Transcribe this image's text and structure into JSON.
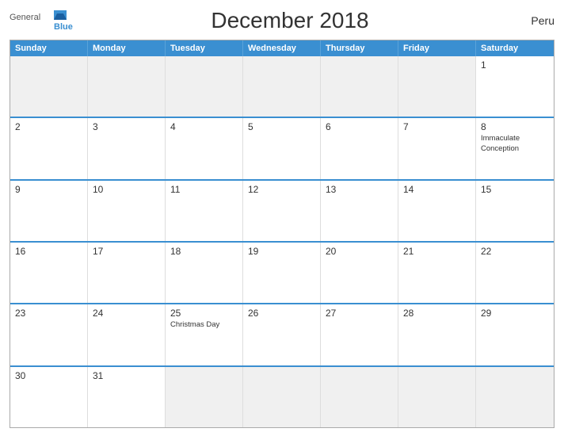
{
  "header": {
    "logo_general": "General",
    "logo_blue": "Blue",
    "title": "December 2018",
    "country": "Peru"
  },
  "weekdays": [
    "Sunday",
    "Monday",
    "Tuesday",
    "Wednesday",
    "Thursday",
    "Friday",
    "Saturday"
  ],
  "weeks": [
    [
      {
        "day": "",
        "empty": true
      },
      {
        "day": "",
        "empty": true
      },
      {
        "day": "",
        "empty": true
      },
      {
        "day": "",
        "empty": true
      },
      {
        "day": "",
        "empty": true
      },
      {
        "day": "",
        "empty": true
      },
      {
        "day": "1",
        "event": ""
      }
    ],
    [
      {
        "day": "2",
        "event": ""
      },
      {
        "day": "3",
        "event": ""
      },
      {
        "day": "4",
        "event": ""
      },
      {
        "day": "5",
        "event": ""
      },
      {
        "day": "6",
        "event": ""
      },
      {
        "day": "7",
        "event": ""
      },
      {
        "day": "8",
        "event": "Immaculate Conception"
      }
    ],
    [
      {
        "day": "9",
        "event": ""
      },
      {
        "day": "10",
        "event": ""
      },
      {
        "day": "11",
        "event": ""
      },
      {
        "day": "12",
        "event": ""
      },
      {
        "day": "13",
        "event": ""
      },
      {
        "day": "14",
        "event": ""
      },
      {
        "day": "15",
        "event": ""
      }
    ],
    [
      {
        "day": "16",
        "event": ""
      },
      {
        "day": "17",
        "event": ""
      },
      {
        "day": "18",
        "event": ""
      },
      {
        "day": "19",
        "event": ""
      },
      {
        "day": "20",
        "event": ""
      },
      {
        "day": "21",
        "event": ""
      },
      {
        "day": "22",
        "event": ""
      }
    ],
    [
      {
        "day": "23",
        "event": ""
      },
      {
        "day": "24",
        "event": ""
      },
      {
        "day": "25",
        "event": "Christmas Day"
      },
      {
        "day": "26",
        "event": ""
      },
      {
        "day": "27",
        "event": ""
      },
      {
        "day": "28",
        "event": ""
      },
      {
        "day": "29",
        "event": ""
      }
    ],
    [
      {
        "day": "30",
        "event": ""
      },
      {
        "day": "31",
        "event": ""
      },
      {
        "day": "",
        "empty": true
      },
      {
        "day": "",
        "empty": true
      },
      {
        "day": "",
        "empty": true
      },
      {
        "day": "",
        "empty": true
      },
      {
        "day": "",
        "empty": true
      }
    ]
  ]
}
